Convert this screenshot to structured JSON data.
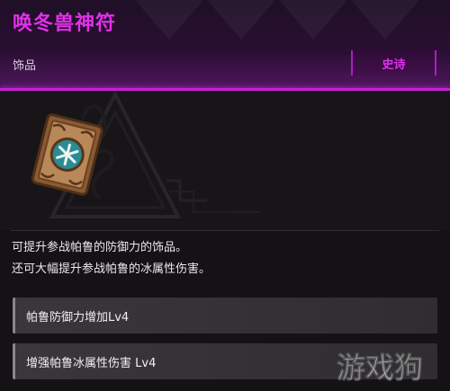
{
  "item": {
    "title": "唤冬兽神符",
    "category": "饰品",
    "rarity_label": "史诗",
    "rarity_color": "#e030e8"
  },
  "description": {
    "line1": "可提升参战帕鲁的防御力的饰品。",
    "line2": "还可大幅提升参战帕鲁的冰属性伤害。"
  },
  "stats": [
    {
      "label": "帕鲁防御力增加Lv4"
    },
    {
      "label": "增强帕鲁冰属性伤害 Lv4"
    }
  ],
  "watermark": {
    "text": "游戏狗"
  }
}
